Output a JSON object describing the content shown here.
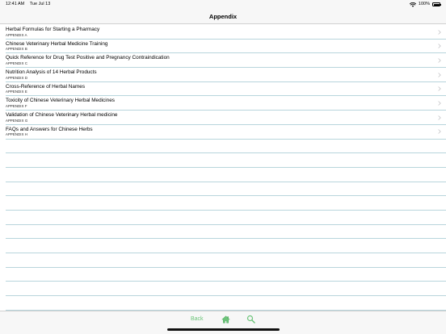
{
  "status_bar": {
    "time": "12:41 AM",
    "date": "Tue Jul 13",
    "battery": "100%"
  },
  "nav": {
    "title": "Appendix"
  },
  "list": {
    "items": [
      {
        "title": "Herbal Formulas for Starting a Pharmacy",
        "subtitle": "APPENDIX A"
      },
      {
        "title": "Chinese Veterinary Herbal Medicine Training",
        "subtitle": "APPENDIX B"
      },
      {
        "title": "Quick Reference for Drug Test Positive and Pregnancy Contraindication",
        "subtitle": "APPENDIX C"
      },
      {
        "title": "Nutrition Analysis of 14 Herbal Products",
        "subtitle": "APPENDIX D"
      },
      {
        "title": "Cross-Reference of Herbal Names",
        "subtitle": "APPENDIX E"
      },
      {
        "title": "Toxicity of Chinese Veterinary Herbal Medicines",
        "subtitle": "APPENDIX F"
      },
      {
        "title": "Validation of Chinese Veterinary Herbal medicine",
        "subtitle": "APPENDIX G"
      },
      {
        "title": "FAQs and Answers for Chinese Herbs",
        "subtitle": "APPENDIX H"
      }
    ]
  },
  "toolbar": {
    "back_label": "Back"
  },
  "colors": {
    "accent": "#6cc47a",
    "separator": "#b8d5dc",
    "bar_background": "#f7f7f7"
  },
  "icons": {
    "chevron": "chevron-right-icon",
    "home": "home-icon",
    "search": "search-icon",
    "wifi": "wifi-icon",
    "battery": "battery-icon"
  }
}
